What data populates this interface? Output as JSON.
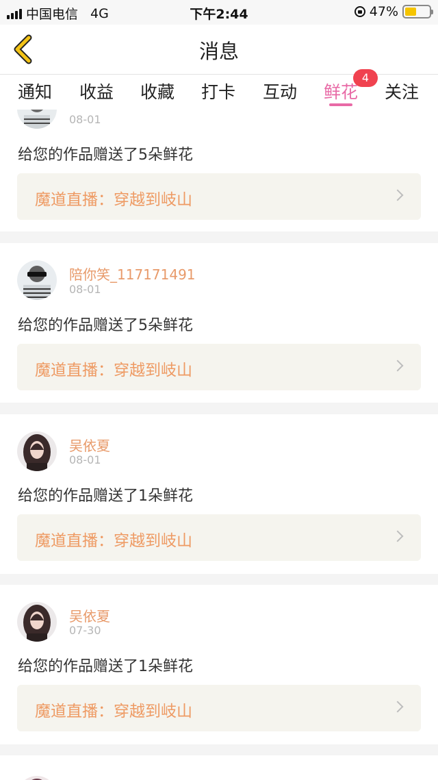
{
  "status_bar": {
    "carrier": "中国电信",
    "network": "4G",
    "time": "下午2:44",
    "battery": "47%",
    "battery_level": 0.47
  },
  "header": {
    "title": "消息"
  },
  "tabs": [
    {
      "label": "通知"
    },
    {
      "label": "收益"
    },
    {
      "label": "收藏"
    },
    {
      "label": "打卡"
    },
    {
      "label": "互动"
    },
    {
      "label": "鲜花",
      "badge": "4",
      "active": true
    },
    {
      "label": "关注"
    }
  ],
  "feed": [
    {
      "username": "",
      "date": "08-01",
      "message": "给您的作品赠送了5朵鲜花",
      "work": "魔道直播：穿越到岐山"
    },
    {
      "username": "陪你笑_117171491",
      "date": "08-01",
      "message": "给您的作品赠送了5朵鲜花",
      "work": "魔道直播：穿越到岐山"
    },
    {
      "username": "吴依夏",
      "date": "08-01",
      "message": "给您的作品赠送了1朵鲜花",
      "work": "魔道直播：穿越到岐山"
    },
    {
      "username": "吴依夏",
      "date": "07-30",
      "message": "给您的作品赠送了1朵鲜花",
      "work": "魔道直播：穿越到岐山"
    }
  ],
  "colors": {
    "accent_pink": "#e86aa6",
    "username_orange": "#e89a6a",
    "link_orange": "#ee9a63",
    "badge_red": "#f0424f",
    "back_icon_yellow": "#f3c316"
  },
  "icons": {
    "back": "chevron-left-icon",
    "link_arrow": "chevron-right-icon"
  }
}
